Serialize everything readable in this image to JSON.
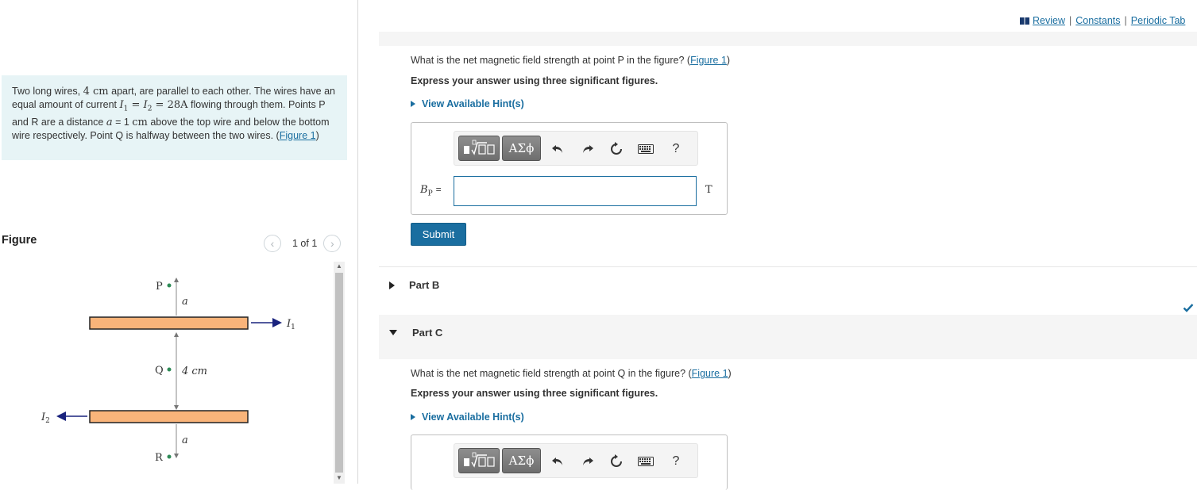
{
  "top_links": {
    "review": "Review",
    "constants": "Constants",
    "periodic": "Periodic Tab",
    "separator": "|"
  },
  "problem": {
    "t1": "Two long wires, ",
    "d1": "4 cm",
    "t2": " apart, are parallel to each other.  The wires have an equal amount of current ",
    "i1": "I",
    "i1sub": "1",
    "eq1": " = ",
    "i2": "I",
    "i2sub": "2",
    "eq2": " =  ",
    "cur": "28A",
    "t3": " flowing through them.  Points P and R are a distance ",
    "a": "a",
    "t4": " = 1 ",
    "cm": "cm",
    "t5": "  above the top wire and below the bottom wire respectively.  Point Q is halfway between the two wires. (",
    "fig_link": "Figure 1",
    "t6": ")"
  },
  "figure": {
    "title": "Figure",
    "pager": "1 of 1",
    "label_p": "P",
    "label_q": "Q",
    "label_r": "R",
    "label_a_top": "a",
    "label_a_bottom": "a",
    "label_dist": "4 cm",
    "label_i1": "I",
    "label_i1_sub": "1",
    "label_i2": "I",
    "label_i2_sub": "2"
  },
  "part_a": {
    "question": "What is the net magnetic field strength at point P in the figure? (",
    "fig_link": "Figure 1",
    "question_end": ")",
    "instruction": "Express your answer using three significant figures.",
    "hint": "View Available Hint(s)",
    "var": "B",
    "var_sub": "P",
    "eq": "=",
    "input_value": "",
    "unit": "T",
    "submit": "Submit",
    "toolbar": {
      "greek": "ΑΣϕ",
      "help": "?"
    }
  },
  "part_b": {
    "label": "Part B",
    "status": "complete"
  },
  "part_c": {
    "label": "Part C",
    "question": "What is the net magnetic field strength at point Q in the figure? (",
    "fig_link": "Figure 1",
    "question_end": ")",
    "instruction": "Express your answer using three significant figures.",
    "hint": "View Available Hint(s)",
    "toolbar": {
      "greek": "ΑΣϕ",
      "help": "?"
    }
  },
  "colors": {
    "accent": "#1a6ea0",
    "wire_fill": "#f9b47a",
    "point_dot": "#2e8b57",
    "arrow": "#1a237e",
    "problem_bg": "#e7f4f6"
  }
}
